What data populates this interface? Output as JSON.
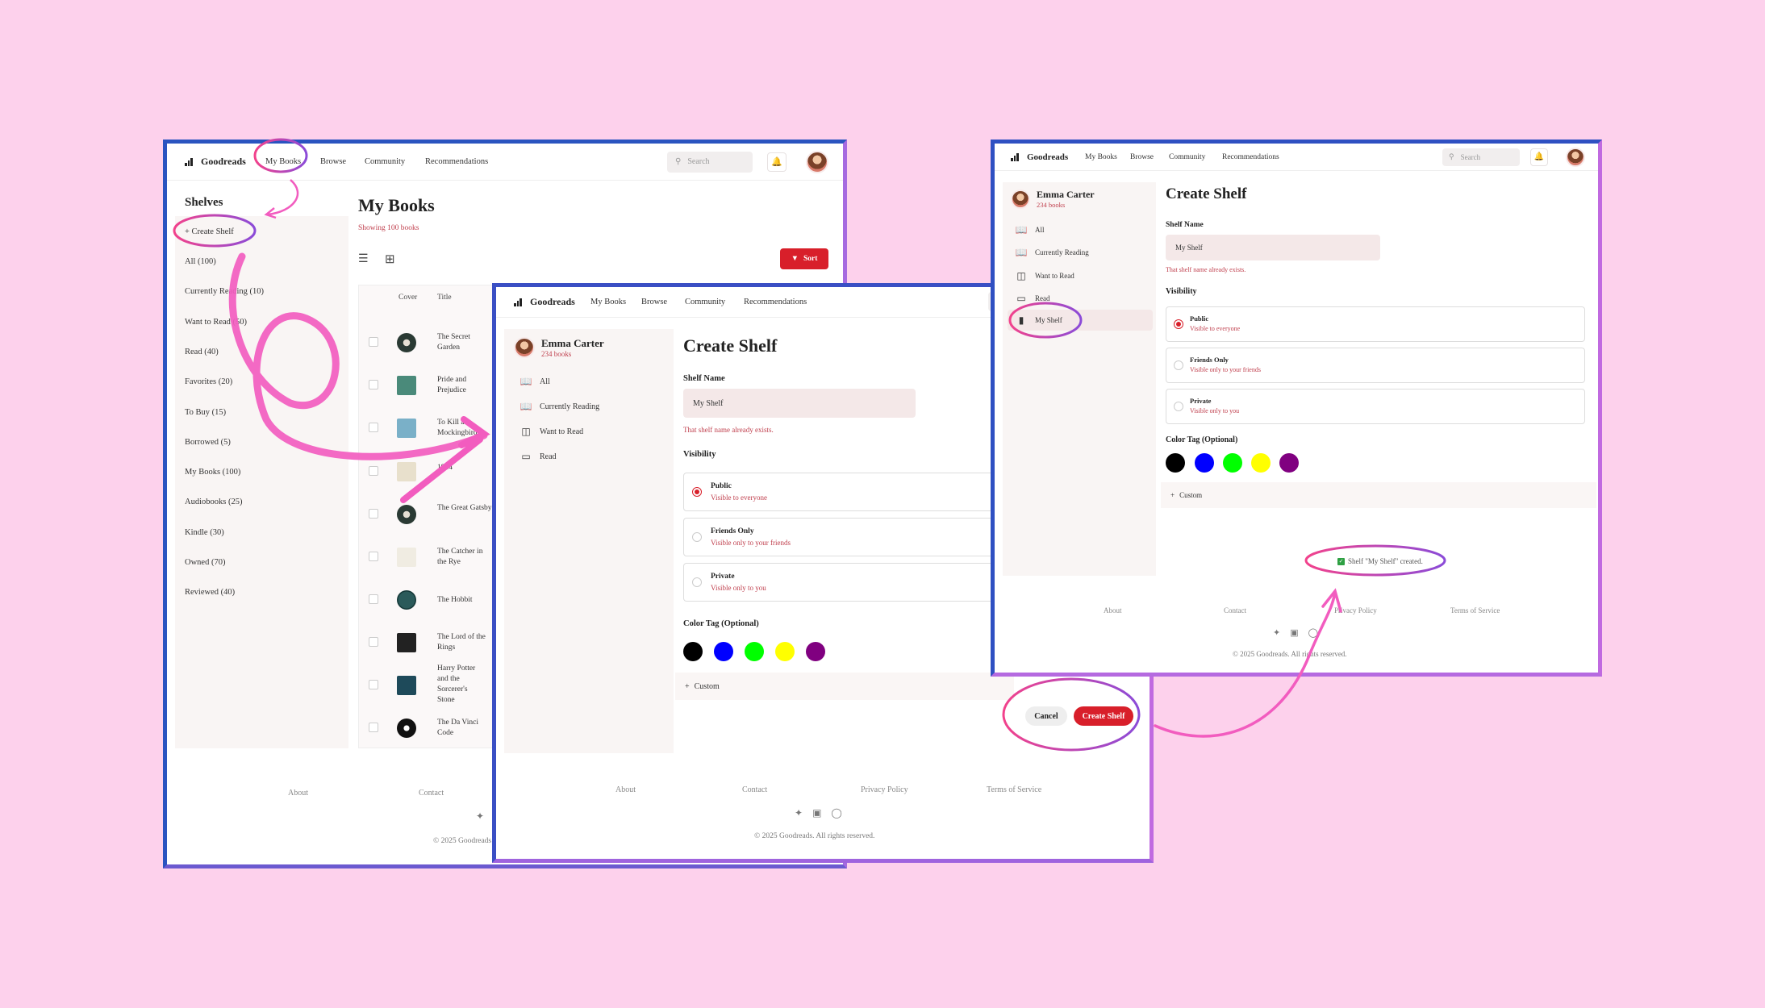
{
  "nav": {
    "logo": "Goodreads",
    "links": [
      "My Books",
      "Browse",
      "Community",
      "Recommendations"
    ],
    "search_placeholder": "Search"
  },
  "screen1": {
    "sidebar_title": "Shelves",
    "create_shelf": "Create Shelf",
    "shelves": [
      "All (100)",
      "Currently Reading (10)",
      "Want to Read (50)",
      "Read (40)",
      "Favorites (20)",
      "To Buy (15)",
      "Borrowed (5)",
      "My Books (100)",
      "Audiobooks (25)",
      "Kindle (30)",
      "Owned (70)",
      "Reviewed (40)"
    ],
    "title": "My Books",
    "subtitle": "Showing 100 books",
    "sort_label": "Sort",
    "columns": [
      "Cover",
      "Title"
    ],
    "books": [
      "The Secret Garden",
      "Pride and Prejudice",
      "To Kill a Mockingbird",
      "1984",
      "The Great Gatsby",
      "The Catcher in the Rye",
      "The Hobbit",
      "The Lord of the Rings",
      "Harry Potter and the Sorcerer's Stone",
      "The Da Vinci Code"
    ],
    "footer": [
      "About",
      "Contact"
    ],
    "copyright": "© 2025 Goodreads"
  },
  "profile": {
    "name": "Emma Carter",
    "count": "234 books"
  },
  "menu2": [
    "All",
    "Currently Reading",
    "Want to Read",
    "Read"
  ],
  "menu3": [
    "All",
    "Currently Reading",
    "Want to Read",
    "Read",
    "My Shelf"
  ],
  "form": {
    "title": "Create Shelf",
    "name_label": "Shelf Name",
    "name_value": "My Shelf",
    "error": "That shelf name already exists.",
    "visibility_label": "Visibility",
    "options": [
      {
        "title": "Public",
        "desc": "Visible to everyone"
      },
      {
        "title": "Friends Only",
        "desc": "Visible only to your friends"
      },
      {
        "title": "Private",
        "desc": "Visible only to you"
      }
    ],
    "color_label": "Color Tag (Optional)",
    "colors": [
      "#000000",
      "#0000ff",
      "#00ff00",
      "#ffff00",
      "#800080"
    ],
    "custom": "Custom",
    "cancel": "Cancel",
    "submit": "Create Shelf"
  },
  "toast": "Shelf \"My Shelf\" created.",
  "footer_links": [
    "About",
    "Contact",
    "Privacy Policy",
    "Terms of Service"
  ],
  "copyright": "© 2025 Goodreads. All rights reserved.",
  "icons": [
    "search-icon",
    "bell-icon",
    "list-view-icon",
    "grid-view-icon",
    "book-open-icon",
    "bookmark-icon",
    "twitter-icon",
    "instagram-icon",
    "facebook-icon"
  ],
  "accent": "#d81f2a",
  "annotation_color": "#f25cbf"
}
